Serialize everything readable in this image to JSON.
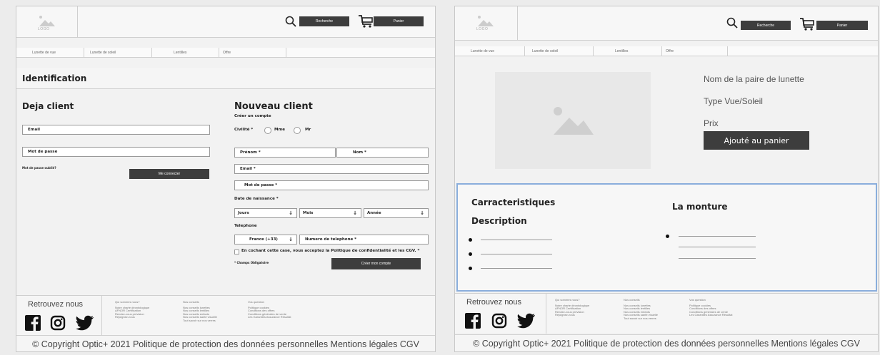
{
  "header": {
    "logo_text": "LOGO",
    "search_label": "Recherche",
    "cart_label": "Panier"
  },
  "nav": {
    "items": [
      "Lunette de vue",
      "Lunette de soleil",
      "Lentilles",
      "Offre"
    ]
  },
  "login_page": {
    "title": "Identification",
    "existing": {
      "heading": "Deja client",
      "email_label": "Email",
      "password_label": "Mot de passe",
      "forgot_label": "Mot de passe oublié?",
      "login_button": "Me connecter"
    },
    "new_client": {
      "heading": "Nouveau client",
      "subheading": "Créer un compte",
      "civility_label": "Civilité *",
      "option_mme": "Mme",
      "option_mr": "Mr",
      "first_name": "Prénom *",
      "last_name": "Nom *",
      "email": "Email *",
      "password": "Mot de passe *",
      "birth_label": "Date de naissance *",
      "day": "Jours",
      "month": "Mois",
      "year": "Année",
      "phone_label": "Telephone",
      "country_code": "France (+33)",
      "phone_number": "Numero de telephone *",
      "terms": "En cochant cette case, vous acceptez la Politique de confidentialité et les CGV. *",
      "required_note": "* Champs Obligatoire",
      "create_button": "Créer mon compte"
    }
  },
  "product_page": {
    "name": "Nom de la paire de lunette",
    "type": "Type Vue/Soleil",
    "price": "Prix",
    "add_to_cart": "Ajouté au panier",
    "characteristics": "Carracteristiques",
    "description": "Description",
    "frame": "La monture"
  },
  "footer": {
    "find_us": "Retrouvez nous",
    "col1": [
      "Qui sommes nous?",
      "Notre charte déontologique",
      "AFNOR Certification",
      "Rendez-vous prévision",
      "Rejoignez-nous"
    ],
    "col2": [
      "Nos conseils",
      "Nos conseils lunettes",
      "Nos conseils lentilles",
      "Nos conseils enfants",
      "Nos conseils santé visuelle",
      "Tout savoir sur nos verres"
    ],
    "col3": [
      "Vos question",
      "Politique cookies",
      "Conditions des offres",
      "Conditions générales de vente",
      "Les Garanties Assurance Résultat"
    ],
    "copyright": "© Copyright Optic+ 2021 Politique de protection des données personnelles Mentions légales CGV"
  }
}
